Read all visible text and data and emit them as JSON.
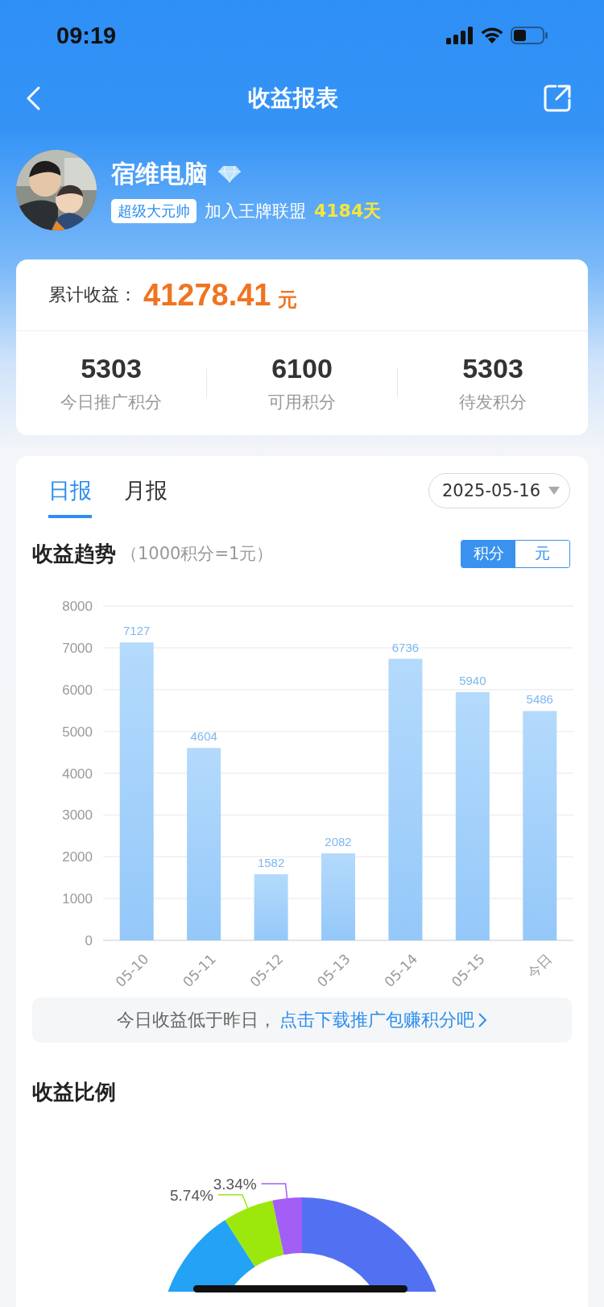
{
  "status_bar": {
    "time": "09:19"
  },
  "nav": {
    "title": "收益报表"
  },
  "profile": {
    "name": "宿维电脑",
    "badge": "超级大元帅",
    "join_text": "加入王牌联盟",
    "join_days": "4184天"
  },
  "summary": {
    "total_label": "累计收益：",
    "total_amount": "41278.41",
    "total_unit": "元",
    "stats": [
      {
        "value": "5303",
        "label": "今日推广积分"
      },
      {
        "value": "6100",
        "label": "可用积分"
      },
      {
        "value": "5303",
        "label": "待发积分"
      }
    ]
  },
  "report": {
    "tabs": [
      {
        "label": "日报",
        "selected": true
      },
      {
        "label": "月报",
        "selected": false
      }
    ],
    "date": "2025-05-16",
    "trend": {
      "title": "收益趋势",
      "note": "（1000积分=1元）",
      "units": [
        {
          "label": "积分",
          "selected": true
        },
        {
          "label": "元",
          "selected": false
        }
      ],
      "chart_data": {
        "type": "bar",
        "categories": [
          "05-10",
          "05-11",
          "05-12",
          "05-13",
          "05-14",
          "05-15",
          "今日"
        ],
        "values": [
          7127,
          4604,
          1582,
          2082,
          6736,
          5940,
          5486
        ],
        "ylim": [
          0,
          8000
        ],
        "yticks": [
          0,
          1000,
          2000,
          3000,
          4000,
          5000,
          6000,
          7000,
          8000
        ],
        "grid": true,
        "data_labels": true
      }
    },
    "tip": {
      "text": "今日收益低于昨日，",
      "link": "点击下载推广包赚积分吧"
    },
    "ratio": {
      "title": "收益比例",
      "labels": [
        {
          "text": "5.74%",
          "color": "#9ce80c"
        },
        {
          "text": "3.34%",
          "color": "#a35ef6"
        }
      ]
    }
  }
}
